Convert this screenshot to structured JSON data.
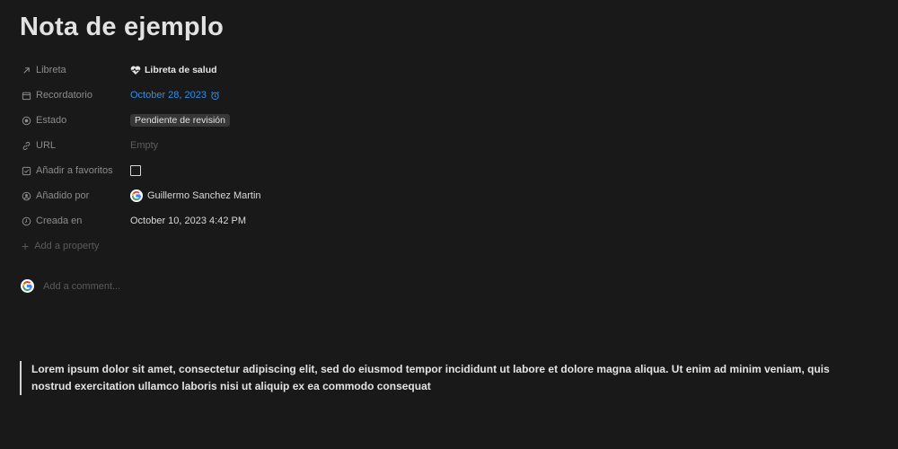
{
  "page": {
    "title": "Nota de ejemplo"
  },
  "properties": {
    "notebook": {
      "label": "Libreta",
      "value": "Libreta de salud",
      "icon": "arrow-up-right-icon"
    },
    "reminder": {
      "label": "Recordatorio",
      "value": "October 28, 2023",
      "icon": "calendar-icon"
    },
    "status": {
      "label": "Estado",
      "value": "Pendiente de revisión",
      "icon": "status-icon"
    },
    "url": {
      "label": "URL",
      "value": "Empty",
      "icon": "link-icon"
    },
    "favorite": {
      "label": "Añadir a favoritos",
      "checked": false,
      "icon": "checkbox-icon"
    },
    "added_by": {
      "label": "Añadido por",
      "value": "Guillermo Sanchez Martin",
      "icon": "person-icon"
    },
    "created": {
      "label": "Creada en",
      "value": "October 10, 2023 4:42 PM",
      "icon": "clock-icon"
    },
    "add_property": "Add a property"
  },
  "comment": {
    "placeholder": "Add a comment..."
  },
  "body": {
    "quote": "Lorem ipsum dolor sit amet, consectetur adipiscing elit, sed do eiusmod tempor incididunt ut labore et dolore magna aliqua. Ut enim ad minim veniam, quis nostrud exercitation ullamco laboris nisi ut aliquip ex ea commodo consequat"
  },
  "colors": {
    "background": "#191919",
    "link_blue": "#2f8fe6",
    "status_bg": "#373737"
  }
}
